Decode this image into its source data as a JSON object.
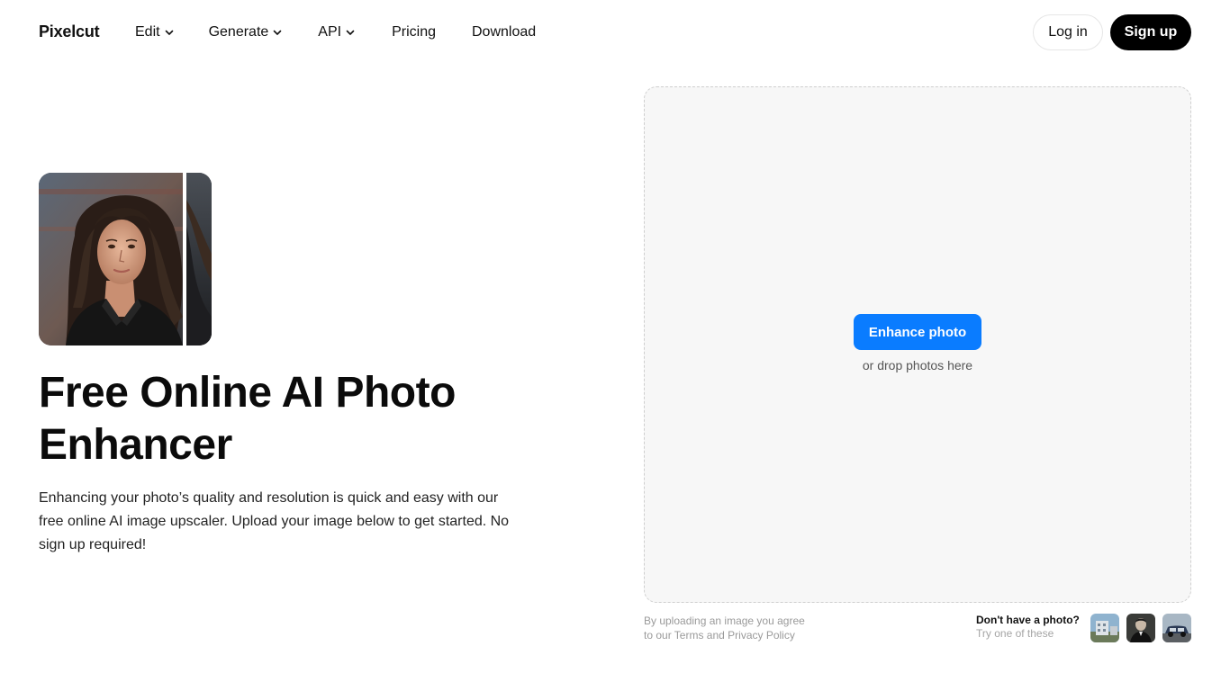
{
  "header": {
    "logo": "Pixelcut",
    "nav": [
      {
        "label": "Edit",
        "dropdown": true
      },
      {
        "label": "Generate",
        "dropdown": true
      },
      {
        "label": "API",
        "dropdown": true
      },
      {
        "label": "Pricing",
        "dropdown": false
      },
      {
        "label": "Download",
        "dropdown": false
      }
    ],
    "login_label": "Log in",
    "signup_label": "Sign up"
  },
  "hero": {
    "title": "Free Online AI Photo Enhancer",
    "description": "Enhancing your photo’s quality and resolution is quick and easy with our free online AI image upscaler. Upload your image below to get started. No sign up required!"
  },
  "upload": {
    "button_label": "Enhance photo",
    "drop_text": "or drop photos here",
    "terms_line1": "By uploading an image you agree",
    "terms_line2": "to our Terms and Privacy Policy",
    "sample_title": "Don't have a photo?",
    "sample_subtitle": "Try one of these"
  },
  "colors": {
    "accent": "#0a7cff",
    "signup_bg": "#000000",
    "dropzone_bg": "#f7f7f7"
  },
  "icons": {
    "nav_dropdown": "chevron-down-icon"
  }
}
